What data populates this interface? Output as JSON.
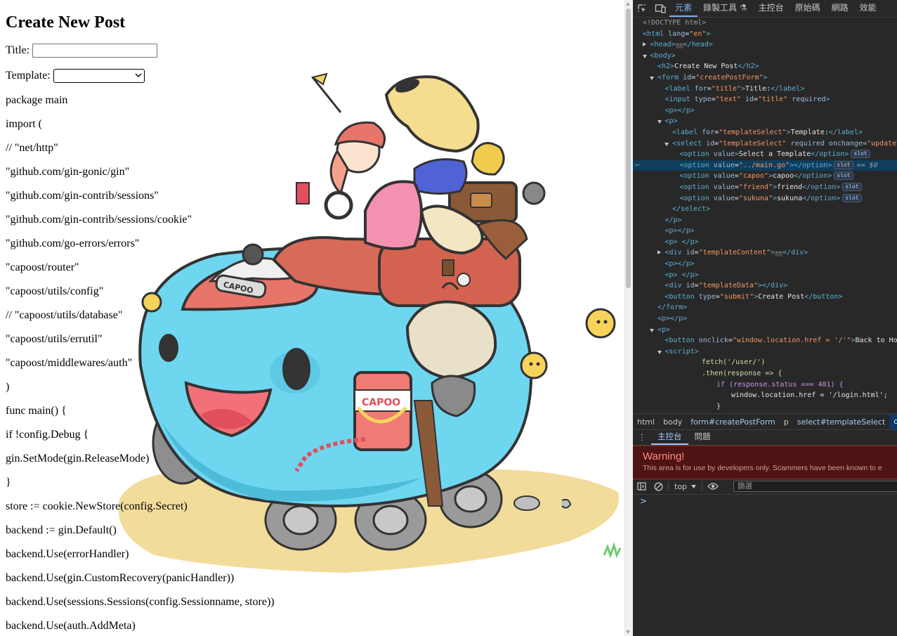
{
  "page": {
    "heading": "Create New Post",
    "title_label": "Title:",
    "title_value": "",
    "template_label": "Template:",
    "template_selected": "",
    "code_lines": [
      "package main",
      "import (",
      "// \"net/http\"",
      "\"github.com/gin-gonic/gin\"",
      "\"github.com/gin-contrib/sessions\"",
      "\"github.com/gin-contrib/sessions/cookie\"",
      "\"github.com/go-errors/errors\"",
      "\"capoost/router\"",
      "\"capoost/utils/config\"",
      "// \"capoost/utils/database\"",
      "\"capoost/utils/errutil\"",
      "\"capoost/middlewares/auth\"",
      ")",
      "func main() {",
      "if !config.Debug {",
      "gin.SetMode(gin.ReleaseMode)",
      "}",
      "store := cookie.NewStore(config.Secret)",
      "backend := gin.Default()",
      "backend.Use(errorHandler)",
      "backend.Use(gin.CustomRecovery(panicHandler))",
      "backend.Use(sessions.Sessions(config.Sessionname, store))",
      "backend.Use(auth.AddMeta)"
    ],
    "illustration": {
      "hat_label": "CAPOO",
      "can_label": "CAPOO"
    }
  },
  "devtools": {
    "tabs": [
      "元素",
      "錄製工具 ⚗",
      "主控台",
      "原始碼",
      "網路",
      "效能"
    ],
    "active_tab": "元素",
    "tree": {
      "doctype": "<!DOCTYPE html>",
      "html_open": {
        "tag": "html",
        "attr": "lang",
        "val": "\"en\""
      },
      "head": "head",
      "body": "body",
      "h2_text": "Create New Post",
      "form_id": "\"createPostForm\"",
      "label_title_for": "\"title\"",
      "label_title_text": "Title:",
      "input_type": "\"text\"",
      "input_id": "\"title\"",
      "input_required": "required",
      "label_tpl_for": "\"templateSelect\"",
      "label_tpl_text": "Template:",
      "select_id": "\"templateSelect\"",
      "select_rest": "required onchange=",
      "select_onchange": "\"updateT",
      "options": [
        {
          "val": "",
          "text": "Select a Template",
          "bare": true
        },
        {
          "val": "\"../main.go\"",
          "text": "",
          "selected": true
        },
        {
          "val": "\"capoo\"",
          "text": "capoo"
        },
        {
          "val": "\"friend\"",
          "text": "friend"
        },
        {
          "val": "\"sukuna\"",
          "text": "sukuna"
        }
      ],
      "slot_badge": "slot",
      "selected_marker": "== $0",
      "div_content_id": "\"templateContent\"",
      "div_data_id": "\"templateData\"",
      "button_type": "\"submit\"",
      "button_text": "Create Post",
      "back_onclick": "\"window.location.href = '/'\"",
      "back_text": "Back to Hom",
      "script_fetch": "fetch('/user/')",
      "script_then": ".then(response => {",
      "script_if": "if (response.status === 401) {",
      "script_loc": "window.location.href = '/login.html';",
      "script_close": "}",
      "script_close2": "});"
    },
    "breadcrumbs": [
      "html",
      "body",
      "form#createPostForm",
      "p",
      "select#templateSelect",
      "optio"
    ],
    "drawer_tabs": [
      "主控台",
      "問題"
    ],
    "warning_title": "Warning!",
    "warning_body": "This area is for use by developers only. Scammers have been known to e",
    "context": "top",
    "filter_placeholder": "篩選",
    "prompt": ">"
  }
}
